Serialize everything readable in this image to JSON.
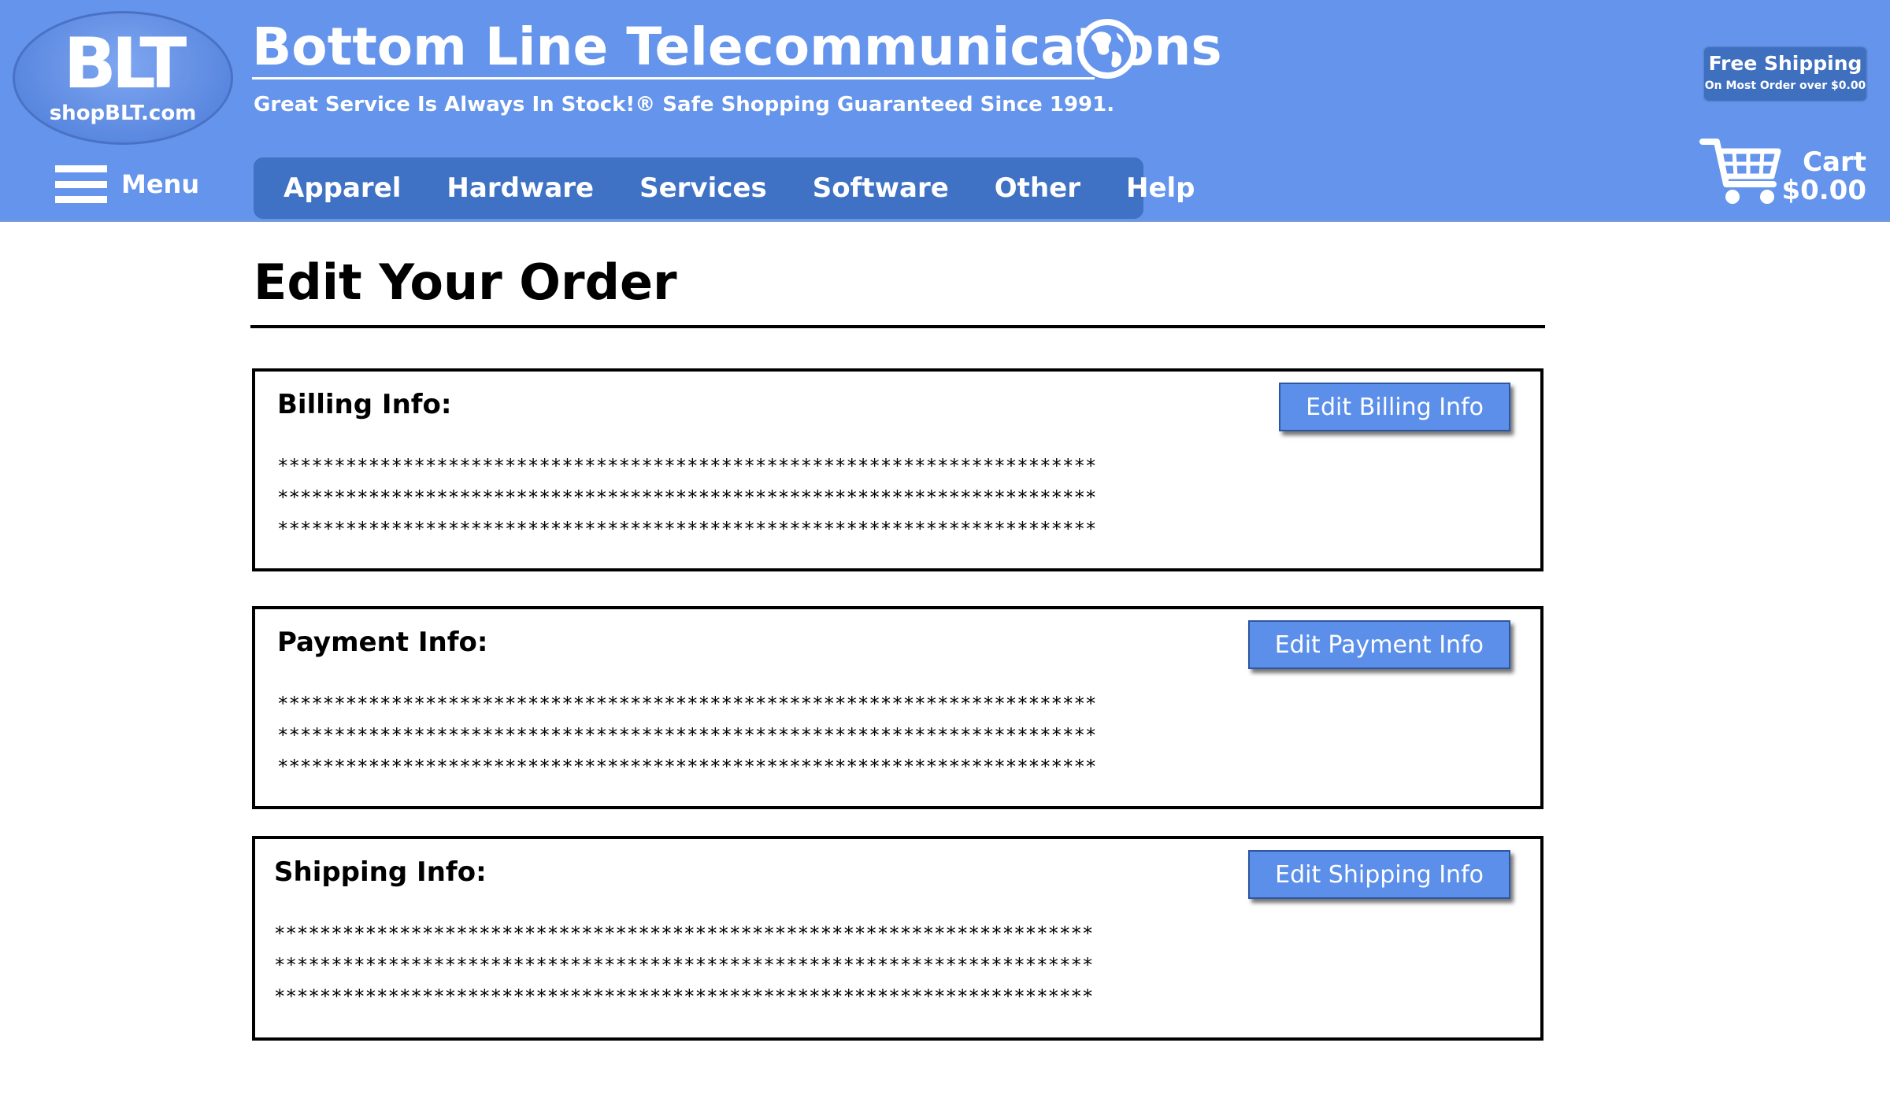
{
  "header": {
    "logo_mark": "BLT",
    "logo_url": "shopBLT.com",
    "brand_title": "Bottom Line Telecommunications",
    "tagline": "Great Service Is Always In Stock!® Safe Shopping Guaranteed Since 1991.",
    "free_shipping_title": "Free Shipping",
    "free_shipping_sub": "On Most Order over $0.00",
    "menu_label": "Menu",
    "nav": [
      "Apparel",
      "Hardware",
      "Services",
      "Software",
      "Other",
      "Help"
    ],
    "cart_label": "Cart",
    "cart_total": "$0.00",
    "colors": {
      "header_bg": "#6494EB",
      "nav_bg": "#3F72C4",
      "button_bg": "#5B8FEA"
    }
  },
  "page": {
    "title": "Edit Your Order",
    "panels": [
      {
        "heading": "Billing Info:",
        "button": "Edit Billing Info",
        "lines": [
          "************************************************************************",
          "************************************************************************",
          "************************************************************************"
        ]
      },
      {
        "heading": "Payment Info:",
        "button": "Edit Payment Info",
        "lines": [
          "************************************************************************",
          "************************************************************************",
          "************************************************************************"
        ]
      },
      {
        "heading": "Shipping Info:",
        "button": "Edit Shipping Info",
        "lines": [
          "************************************************************************",
          "************************************************************************",
          "************************************************************************"
        ]
      }
    ]
  }
}
